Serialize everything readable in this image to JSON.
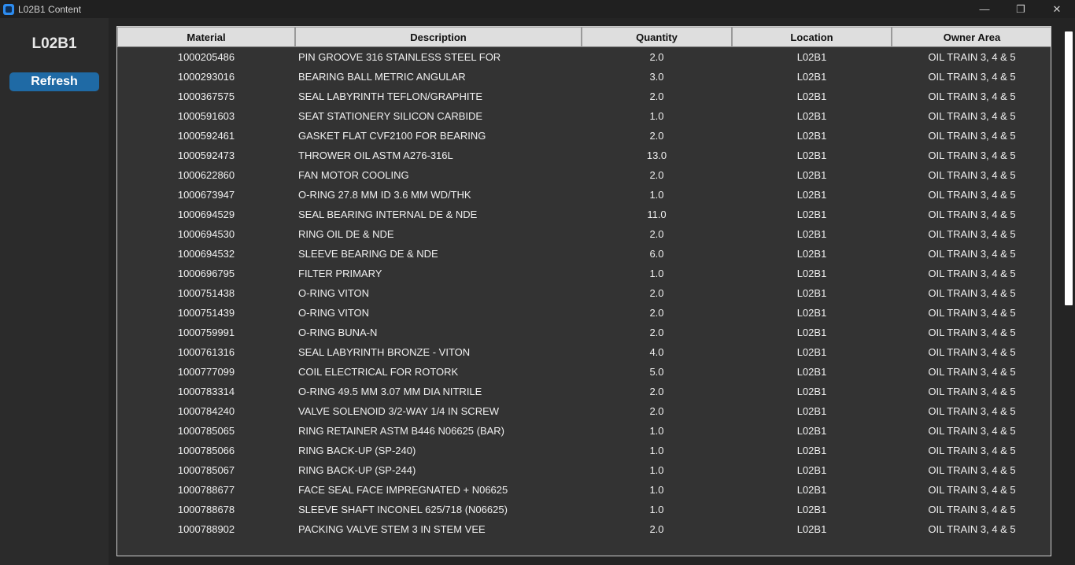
{
  "window": {
    "title": "L02B1 Content",
    "controls": [
      "—",
      "❐",
      "✕"
    ]
  },
  "sidebar": {
    "title": "L02B1",
    "refresh_label": "Refresh"
  },
  "table": {
    "columns": [
      "Material",
      "Description",
      "Quantity",
      "Location",
      "Owner Area"
    ],
    "rows": [
      [
        "1000205486",
        "PIN  GROOVE  316 STAINLESS STEEL  FOR",
        "2.0",
        "L02B1",
        "OIL TRAIN 3, 4 & 5"
      ],
      [
        "1000293016",
        "BEARING  BALL  METRIC  ANGULAR",
        "3.0",
        "L02B1",
        "OIL TRAIN 3, 4 & 5"
      ],
      [
        "1000367575",
        "SEAL  LABYRINTH  TEFLON/GRAPHITE",
        "2.0",
        "L02B1",
        "OIL TRAIN 3, 4 & 5"
      ],
      [
        "1000591603",
        "SEAT  STATIONERY  SILICON CARBIDE",
        "1.0",
        "L02B1",
        "OIL TRAIN 3, 4 & 5"
      ],
      [
        "1000592461",
        "GASKET  FLAT  CVF2100  FOR BEARING",
        "2.0",
        "L02B1",
        "OIL TRAIN 3, 4 & 5"
      ],
      [
        "1000592473",
        "THROWER  OIL  ASTM A276-316L",
        "13.0",
        "L02B1",
        "OIL TRAIN 3, 4 & 5"
      ],
      [
        "1000622860",
        "FAN  MOTOR  COOLING",
        "2.0",
        "L02B1",
        "OIL TRAIN 3, 4 & 5"
      ],
      [
        "1000673947",
        "O-RING  27.8 MM ID  3.6 MM WD/THK",
        "1.0",
        "L02B1",
        "OIL TRAIN 3, 4 & 5"
      ],
      [
        "1000694529",
        "SEAL  BEARING  INTERNAL  DE & NDE",
        "11.0",
        "L02B1",
        "OIL TRAIN 3, 4 & 5"
      ],
      [
        "1000694530",
        "RING  OIL  DE & NDE",
        "2.0",
        "L02B1",
        "OIL TRAIN 3, 4 & 5"
      ],
      [
        "1000694532",
        "SLEEVE  BEARING  DE & NDE",
        "6.0",
        "L02B1",
        "OIL TRAIN 3, 4 & 5"
      ],
      [
        "1000696795",
        "FILTER  PRIMARY",
        "1.0",
        "L02B1",
        "OIL TRAIN 3, 4 & 5"
      ],
      [
        "1000751438",
        "O-RING  VITON",
        "2.0",
        "L02B1",
        "OIL TRAIN 3, 4 & 5"
      ],
      [
        "1000751439",
        "O-RING  VITON",
        "2.0",
        "L02B1",
        "OIL TRAIN 3, 4 & 5"
      ],
      [
        "1000759991",
        "O-RING  BUNA-N",
        "2.0",
        "L02B1",
        "OIL TRAIN 3, 4 & 5"
      ],
      [
        "1000761316",
        "SEAL  LABYRINTH  BRONZE - VITON",
        "4.0",
        "L02B1",
        "OIL TRAIN 3, 4 & 5"
      ],
      [
        "1000777099",
        "COIL  ELECTRICAL  FOR ROTORK",
        "5.0",
        "L02B1",
        "OIL TRAIN 3, 4 & 5"
      ],
      [
        "1000783314",
        "O-RING  49.5 MM  3.07 MM DIA  NITRILE",
        "2.0",
        "L02B1",
        "OIL TRAIN 3, 4 & 5"
      ],
      [
        "1000784240",
        "VALVE  SOLENOID  3/2-WAY  1/4 IN  SCREW",
        "2.0",
        "L02B1",
        "OIL TRAIN 3, 4 & 5"
      ],
      [
        "1000785065",
        "RING  RETAINER  ASTM B446 N06625 (BAR)",
        "1.0",
        "L02B1",
        "OIL TRAIN 3, 4 & 5"
      ],
      [
        "1000785066",
        "RING  BACK-UP  (SP-240)",
        "1.0",
        "L02B1",
        "OIL TRAIN 3, 4 & 5"
      ],
      [
        "1000785067",
        "RING  BACK-UP  (SP-244)",
        "1.0",
        "L02B1",
        "OIL TRAIN 3, 4 & 5"
      ],
      [
        "1000788677",
        "FACE  SEAL FACE  IMPREGNATED + N06625",
        "1.0",
        "L02B1",
        "OIL TRAIN 3, 4 & 5"
      ],
      [
        "1000788678",
        "SLEEVE  SHAFT  INCONEL 625/718 (N06625)",
        "1.0",
        "L02B1",
        "OIL TRAIN 3, 4 & 5"
      ],
      [
        "1000788902",
        "PACKING  VALVE STEM  3 IN STEM  VEE",
        "2.0",
        "L02B1",
        "OIL TRAIN 3, 4 & 5"
      ]
    ]
  },
  "colors": {
    "accent": "#1f6aa5",
    "table_bg": "#333333",
    "header_bg": "#dedede"
  }
}
